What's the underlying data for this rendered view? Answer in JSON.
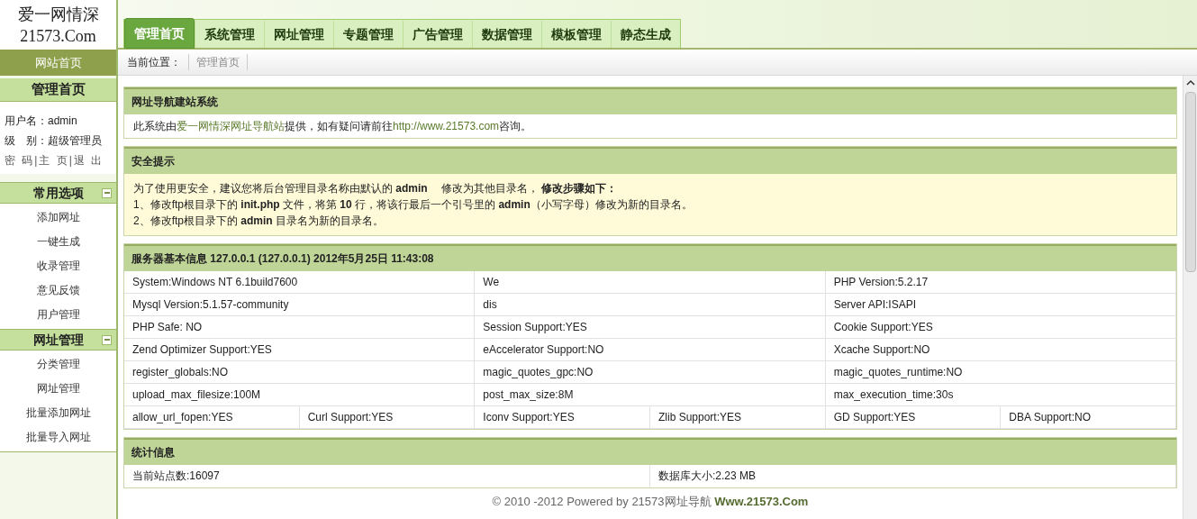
{
  "logo": {
    "line_1": "爱一网情深",
    "line_2": "21573.Com"
  },
  "tabs": [
    {
      "label": "管理首页",
      "selected": true
    },
    {
      "label": "系统管理",
      "selected": false
    },
    {
      "label": "网址管理",
      "selected": false
    },
    {
      "label": "专题管理",
      "selected": false
    },
    {
      "label": "广告管理",
      "selected": false
    },
    {
      "label": "数据管理",
      "selected": false
    },
    {
      "label": "模板管理",
      "selected": false
    },
    {
      "label": "静态生成",
      "selected": false
    }
  ],
  "breadcrumb": {
    "label": "当前位置：",
    "items": [
      "管理首页"
    ]
  },
  "sidebar": {
    "home_link": "网站首页",
    "title": "管理首页",
    "user": [
      {
        "label": "用户名：",
        "value": "admin"
      },
      {
        "label": "级　别：",
        "value": "超级管理员"
      }
    ],
    "links": [
      "密 码",
      "|主 页",
      "|退 出"
    ],
    "sections": [
      {
        "title": "常用选项",
        "expanded": true,
        "items": [
          "添加网址",
          "一键生成",
          "收录管理",
          "意见反馈",
          "用户管理"
        ]
      },
      {
        "title": "网址管理",
        "expanded": true,
        "items": [
          "分类管理",
          "网址管理",
          "批量添加网址",
          "批量导入网址"
        ]
      }
    ]
  },
  "intro": {
    "title": "网址导航建站系统",
    "parts": [
      {
        "kind": "text",
        "text": "此系统由"
      },
      {
        "kind": "link",
        "text": "爱一网情深网址导航站"
      },
      {
        "kind": "text",
        "text": "提供，如有疑问请前往"
      },
      {
        "kind": "link",
        "text": "http://www.21573.com"
      },
      {
        "kind": "text",
        "text": "咨询。"
      }
    ]
  },
  "security": {
    "title": "安全提示",
    "lines": [
      "为了使用更安全，建议您将后台管理目录名称由默认的 **admin** 　修改为其他目录名， **修改步骤如下：**",
      "1、修改ftp根目录下的 **init.php** 文件，将第 **10** 行，将该行最后一个引号里的 **admin**（小写字母）修改为新的目录名。",
      "2、修改ftp根目录下的 **admin** 目录名为新的目录名。"
    ]
  },
  "server": {
    "title": "服务器基本信息 127.0.0.1 (127.0.0.1)  2012年5月25日 11:43:08",
    "rows": [
      [
        "System:Windows NT 6.1build7600",
        "We",
        "PHP Version:5.2.17"
      ],
      [
        "Mysql Version:5.1.57-community",
        "dis",
        "Server API:ISAPI"
      ],
      [
        "PHP Safe: NO",
        "Session Support:YES",
        "Cookie Support:YES"
      ],
      [
        "Zend Optimizer Support:YES",
        "eAccelerator Support:NO",
        "Xcache Support:NO"
      ],
      [
        "register_globals:NO",
        "magic_quotes_gpc:NO",
        "magic_quotes_runtime:NO"
      ],
      [
        "upload_max_filesize:100M",
        "post_max_size:8M",
        "max_execution_time:30s"
      ],
      [
        [
          "allow_url_fopen:YES",
          "Curl Support:YES"
        ],
        [
          "Iconv Support:YES",
          "Zlib Support:YES"
        ],
        [
          "GD Support:YES",
          "DBA Support:NO"
        ]
      ]
    ]
  },
  "stats": {
    "title": "统计信息",
    "cells": [
      "当前站点数:16097",
      "数据库大小:2.23 MB"
    ]
  },
  "footer": {
    "text": "© 2010 -2012 Powered by 21573网址导航 ",
    "brand": "Www.21573.Com"
  }
}
